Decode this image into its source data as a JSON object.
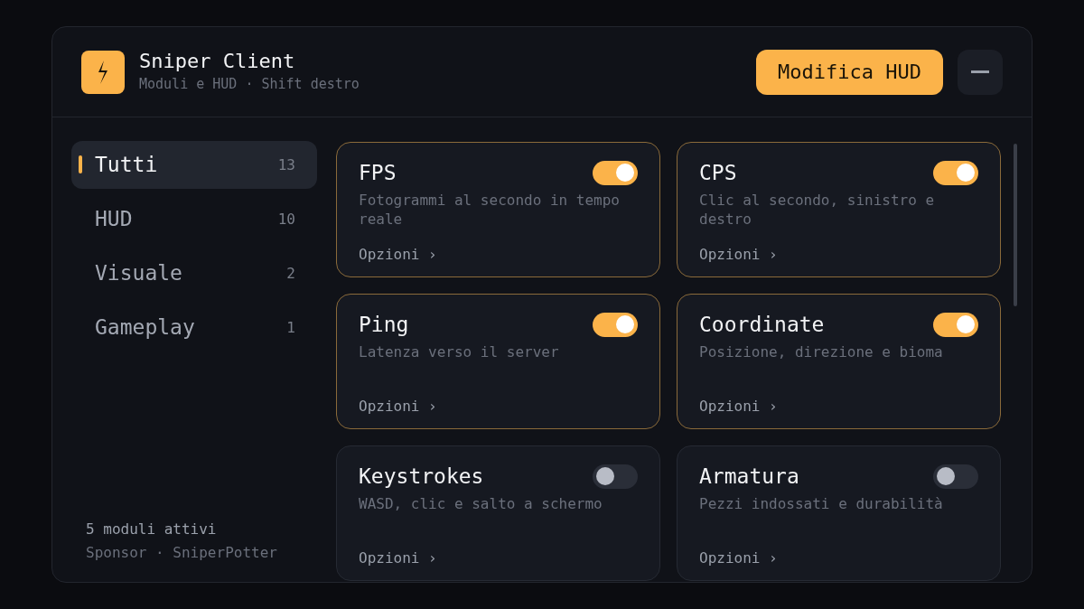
{
  "header": {
    "title": "Sniper Client",
    "subtitle": "Moduli e HUD · Shift destro",
    "edit_button": "Modifica HUD"
  },
  "sidebar": {
    "items": [
      {
        "label": "Tutti",
        "count": "13",
        "selected": true
      },
      {
        "label": "HUD",
        "count": "10",
        "selected": false
      },
      {
        "label": "Visuale",
        "count": "2",
        "selected": false
      },
      {
        "label": "Gameplay",
        "count": "1",
        "selected": false
      }
    ],
    "footer": [
      "5 moduli attivi",
      "Sponsor · SniperPotter"
    ]
  },
  "modules": [
    {
      "name": "FPS",
      "description": "Fotogrammi al secondo in tempo reale",
      "on": true,
      "options": "Opzioni ›"
    },
    {
      "name": "CPS",
      "description": "Clic al secondo, sinistro e destro",
      "on": true,
      "options": "Opzioni ›"
    },
    {
      "name": "Ping",
      "description": "Latenza verso il server",
      "on": true,
      "options": "Opzioni ›"
    },
    {
      "name": "Coordinate",
      "description": "Posizione, direzione e bioma",
      "on": true,
      "options": "Opzioni ›"
    },
    {
      "name": "Keystrokes",
      "description": "WASD, clic e salto a schermo",
      "on": false,
      "options": "Opzioni ›"
    },
    {
      "name": "Armatura",
      "description": "Pezzi indossati e durabilità",
      "on": false,
      "options": "Opzioni ›"
    }
  ]
}
